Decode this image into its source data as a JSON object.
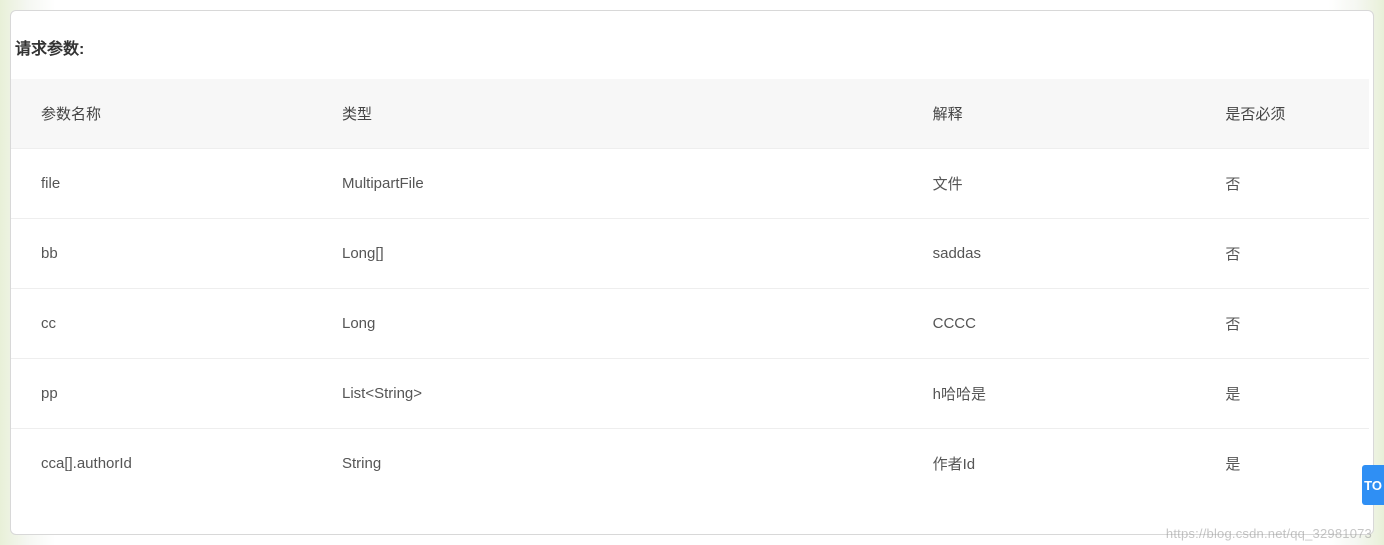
{
  "section": {
    "title": "请求参数:"
  },
  "columns": {
    "name": "参数名称",
    "type": "类型",
    "desc": "解释",
    "required": "是否必须"
  },
  "rows": [
    {
      "name": "file",
      "type": "MultipartFile",
      "desc": "文件",
      "required": "否"
    },
    {
      "name": "bb",
      "type": "Long[]",
      "desc": "saddas",
      "required": "否"
    },
    {
      "name": "cc",
      "type": "Long",
      "desc": "CCCC",
      "required": "否"
    },
    {
      "name": "pp",
      "type": "List<String>",
      "desc": "h哈哈是",
      "required": "是"
    },
    {
      "name": "cca[].authorId",
      "type": "String",
      "desc": "作者Id",
      "required": "是"
    }
  ],
  "watermark": "https://blog.csdn.net/qq_32981073",
  "badge": "TO"
}
